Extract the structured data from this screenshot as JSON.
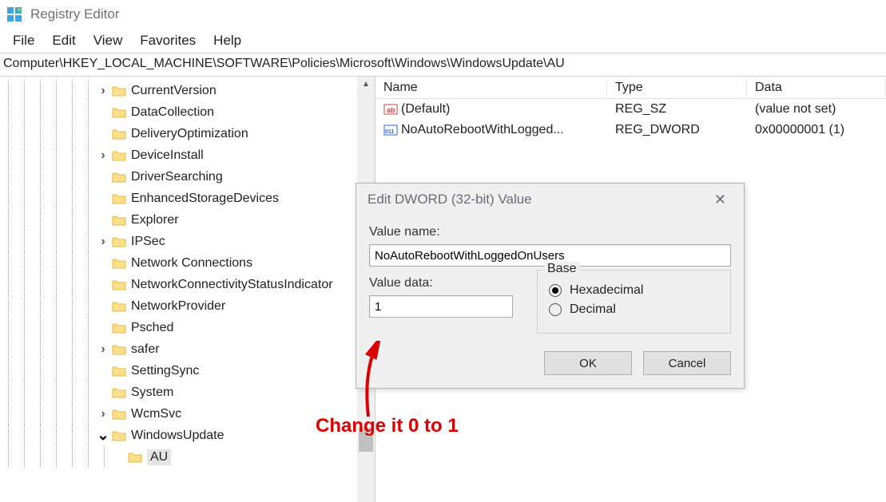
{
  "title": "Registry Editor",
  "menus": {
    "file": "File",
    "edit": "Edit",
    "view": "View",
    "favorites": "Favorites",
    "help": "Help"
  },
  "address": "Computer\\HKEY_LOCAL_MACHINE\\SOFTWARE\\Policies\\Microsoft\\Windows\\WindowsUpdate\\AU",
  "tree": [
    {
      "label": "CurrentVersion",
      "depth": 8,
      "exp": ">"
    },
    {
      "label": "DataCollection",
      "depth": 8,
      "exp": ""
    },
    {
      "label": "DeliveryOptimization",
      "depth": 8,
      "exp": ""
    },
    {
      "label": "DeviceInstall",
      "depth": 8,
      "exp": ">"
    },
    {
      "label": "DriverSearching",
      "depth": 8,
      "exp": ""
    },
    {
      "label": "EnhancedStorageDevices",
      "depth": 8,
      "exp": ""
    },
    {
      "label": "Explorer",
      "depth": 8,
      "exp": ""
    },
    {
      "label": "IPSec",
      "depth": 8,
      "exp": ">"
    },
    {
      "label": "Network Connections",
      "depth": 8,
      "exp": ""
    },
    {
      "label": "NetworkConnectivityStatusIndicator",
      "depth": 8,
      "exp": ""
    },
    {
      "label": "NetworkProvider",
      "depth": 8,
      "exp": ""
    },
    {
      "label": "Psched",
      "depth": 8,
      "exp": ""
    },
    {
      "label": "safer",
      "depth": 8,
      "exp": ">"
    },
    {
      "label": "SettingSync",
      "depth": 8,
      "exp": ""
    },
    {
      "label": "System",
      "depth": 8,
      "exp": ""
    },
    {
      "label": "WcmSvc",
      "depth": 8,
      "exp": ">"
    },
    {
      "label": "WindowsUpdate",
      "depth": 8,
      "exp": "v"
    },
    {
      "label": "AU",
      "depth": 9,
      "exp": "",
      "selected": true
    }
  ],
  "list": {
    "headers": {
      "name": "Name",
      "type": "Type",
      "data": "Data"
    },
    "rows": [
      {
        "name": "(Default)",
        "type": "REG_SZ",
        "data": "(value not set)",
        "icon": "sz"
      },
      {
        "name": "NoAutoRebootWithLogged...",
        "type": "REG_DWORD",
        "data": "0x00000001 (1)",
        "icon": "dw"
      }
    ]
  },
  "dialog": {
    "title": "Edit DWORD (32-bit) Value",
    "value_name_label": "Value name:",
    "value_name": "NoAutoRebootWithLoggedOnUsers",
    "value_data_label": "Value data:",
    "value_data": "1",
    "base_label": "Base",
    "hex": "Hexadecimal",
    "dec": "Decimal",
    "ok": "OK",
    "cancel": "Cancel"
  },
  "annotation": "Change it 0 to 1"
}
